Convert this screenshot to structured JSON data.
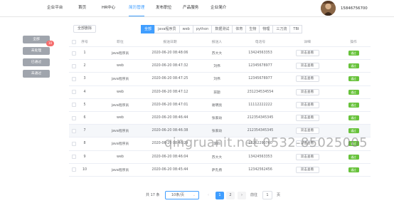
{
  "nav": {
    "items": [
      "企业平台",
      "首页",
      "HR中心",
      "简历管理",
      "发布职位",
      "产品服务",
      "企业简介"
    ],
    "active_index": 3,
    "phone": "15846756700"
  },
  "sidebar": {
    "buttons": [
      "全部",
      "未处理",
      "已通过",
      "未通过"
    ],
    "badge": "10"
  },
  "toolbar": {
    "delete_all": "全部删除",
    "tabs": [
      "全部",
      "java程序员",
      "web",
      "python",
      "数据测试",
      "体育",
      "生物",
      "物理",
      "三刀流",
      "TBI"
    ],
    "active_tab": 0
  },
  "table": {
    "headers": [
      "序号",
      "职位",
      "报送日期",
      "报送人",
      "电话号",
      "详细",
      "操作"
    ],
    "view_label": "双击查看",
    "action_label": "通过",
    "rows": [
      {
        "no": "1",
        "job": "java程序员",
        "date": "2020-06-20 08:48:06",
        "name": "苏大大",
        "phone": "13424563353"
      },
      {
        "no": "2",
        "job": "web",
        "date": "2020-06-20 08:47:32",
        "name": "刘伟",
        "phone": "12345678977"
      },
      {
        "no": "3",
        "job": "java程序员",
        "date": "2020-06-20 08:47:25",
        "name": "刘伟",
        "phone": "12345678977"
      },
      {
        "no": "4",
        "job": "web",
        "date": "2020-06-20 08:47:12",
        "name": "孩题",
        "phone": "231234534554"
      },
      {
        "no": "5",
        "job": "java程序员",
        "date": "2020-06-20 08:47:01",
        "name": "谢明亮",
        "phone": "11112222222"
      },
      {
        "no": "6",
        "job": "web",
        "date": "2020-06-20 08:46:44",
        "name": "张家幼",
        "phone": "212354345345"
      },
      {
        "no": "7",
        "job": "java程序员",
        "date": "2020-06-20 08:46:38",
        "name": "张家幼",
        "phone": "212354345345"
      },
      {
        "no": "8",
        "job": "java程序员",
        "date": "2020-06-20 08:46:29",
        "name": "李四",
        "phone": "13262290760"
      },
      {
        "no": "9",
        "job": "web",
        "date": "2020-06-20 08:46:04",
        "name": "苏大大",
        "phone": "13424563353"
      },
      {
        "no": "10",
        "job": "java程序员",
        "date": "2020-06-20 08:45:44",
        "name": "萨孔扬",
        "phone": "12342562456"
      }
    ]
  },
  "pager": {
    "total": "共 17 条",
    "page_size": "10条/页",
    "prev": "‹",
    "pages": [
      "1",
      "2"
    ],
    "active_page": 0,
    "next": "›",
    "goto_label": "前往",
    "goto_value": "1",
    "page_unit": "页"
  },
  "watermark": "qingruanit.net 0532-85025005"
}
